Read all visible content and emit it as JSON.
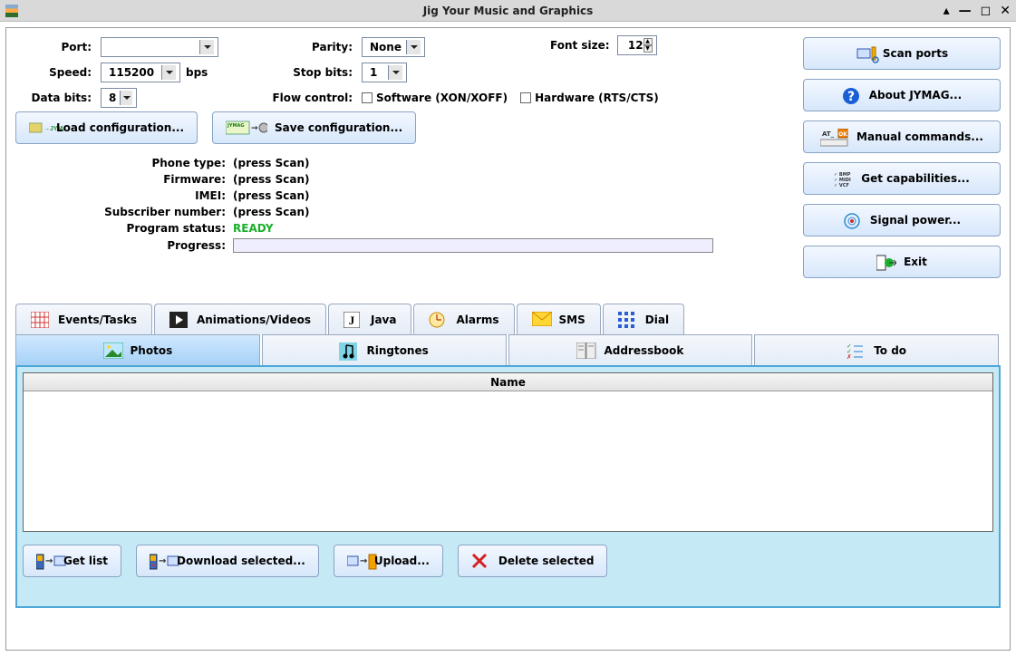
{
  "window": {
    "title": "Jig Your Music and Graphics"
  },
  "settings": {
    "port_label": "Port:",
    "port_value": "",
    "speed_label": "Speed:",
    "speed_value": "115200",
    "speed_unit": "bps",
    "databits_label": "Data bits:",
    "databits_value": "8",
    "parity_label": "Parity:",
    "parity_value": "None",
    "stopbits_label": "Stop bits:",
    "stopbits_value": "1",
    "flow_label": "Flow control:",
    "flow_software": "Software (XON/XOFF)",
    "flow_hardware": "Hardware (RTS/CTS)",
    "font_label": "Font size:",
    "font_value": "12"
  },
  "cfg_buttons": {
    "load": "Load configuration...",
    "save": "Save configuration..."
  },
  "info": {
    "phone_type_label": "Phone type:",
    "phone_type_value": "(press Scan)",
    "firmware_label": "Firmware:",
    "firmware_value": "(press Scan)",
    "imei_label": "IMEI:",
    "imei_value": "(press Scan)",
    "subscriber_label": "Subscriber number:",
    "subscriber_value": "(press Scan)",
    "status_label": "Program status:",
    "status_value": "READY",
    "progress_label": "Progress:"
  },
  "sidebar": {
    "scan": "Scan ports",
    "about": "About JYMAG...",
    "manual": "Manual commands...",
    "caps": "Get capabilities...",
    "signal": "Signal power...",
    "exit": "Exit"
  },
  "tabs_row1": {
    "events": "Events/Tasks",
    "anim": "Animations/Videos",
    "java": "Java",
    "alarms": "Alarms",
    "sms": "SMS",
    "dial": "Dial"
  },
  "tabs_row2": {
    "photos": "Photos",
    "ringtones": "Ringtones",
    "addressbook": "Addressbook",
    "todo": "To do"
  },
  "table": {
    "header": "Name"
  },
  "actions": {
    "get_list": "Get list",
    "download": "Download selected...",
    "upload": "Upload...",
    "delete": "Delete selected"
  }
}
